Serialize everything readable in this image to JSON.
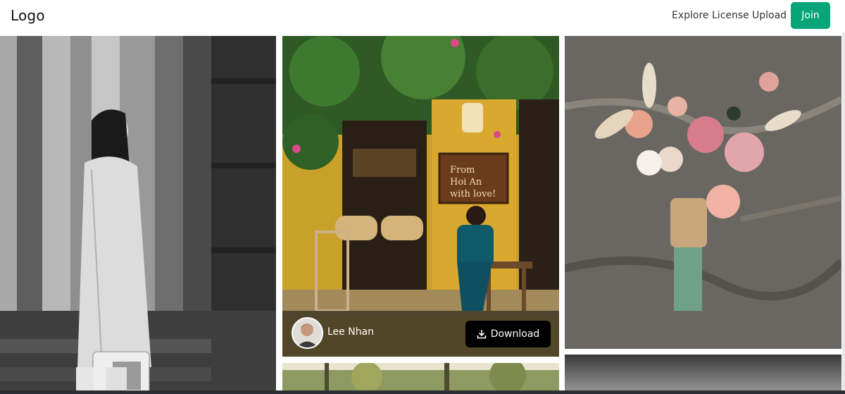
{
  "header": {
    "logo": "Logo",
    "nav": {
      "explore": "Explore",
      "license": "License",
      "upload": "Upload"
    },
    "join_label": "Join"
  },
  "cards": {
    "featured": {
      "author": "Lee Nhan",
      "download_label": "Download",
      "sign_text_1": "From",
      "sign_text_2": "Hoi An",
      "sign_text_3": "with love!"
    }
  },
  "colors": {
    "accent": "#08a579",
    "download_bg": "#000000",
    "overlay_bg": "#483e28"
  }
}
